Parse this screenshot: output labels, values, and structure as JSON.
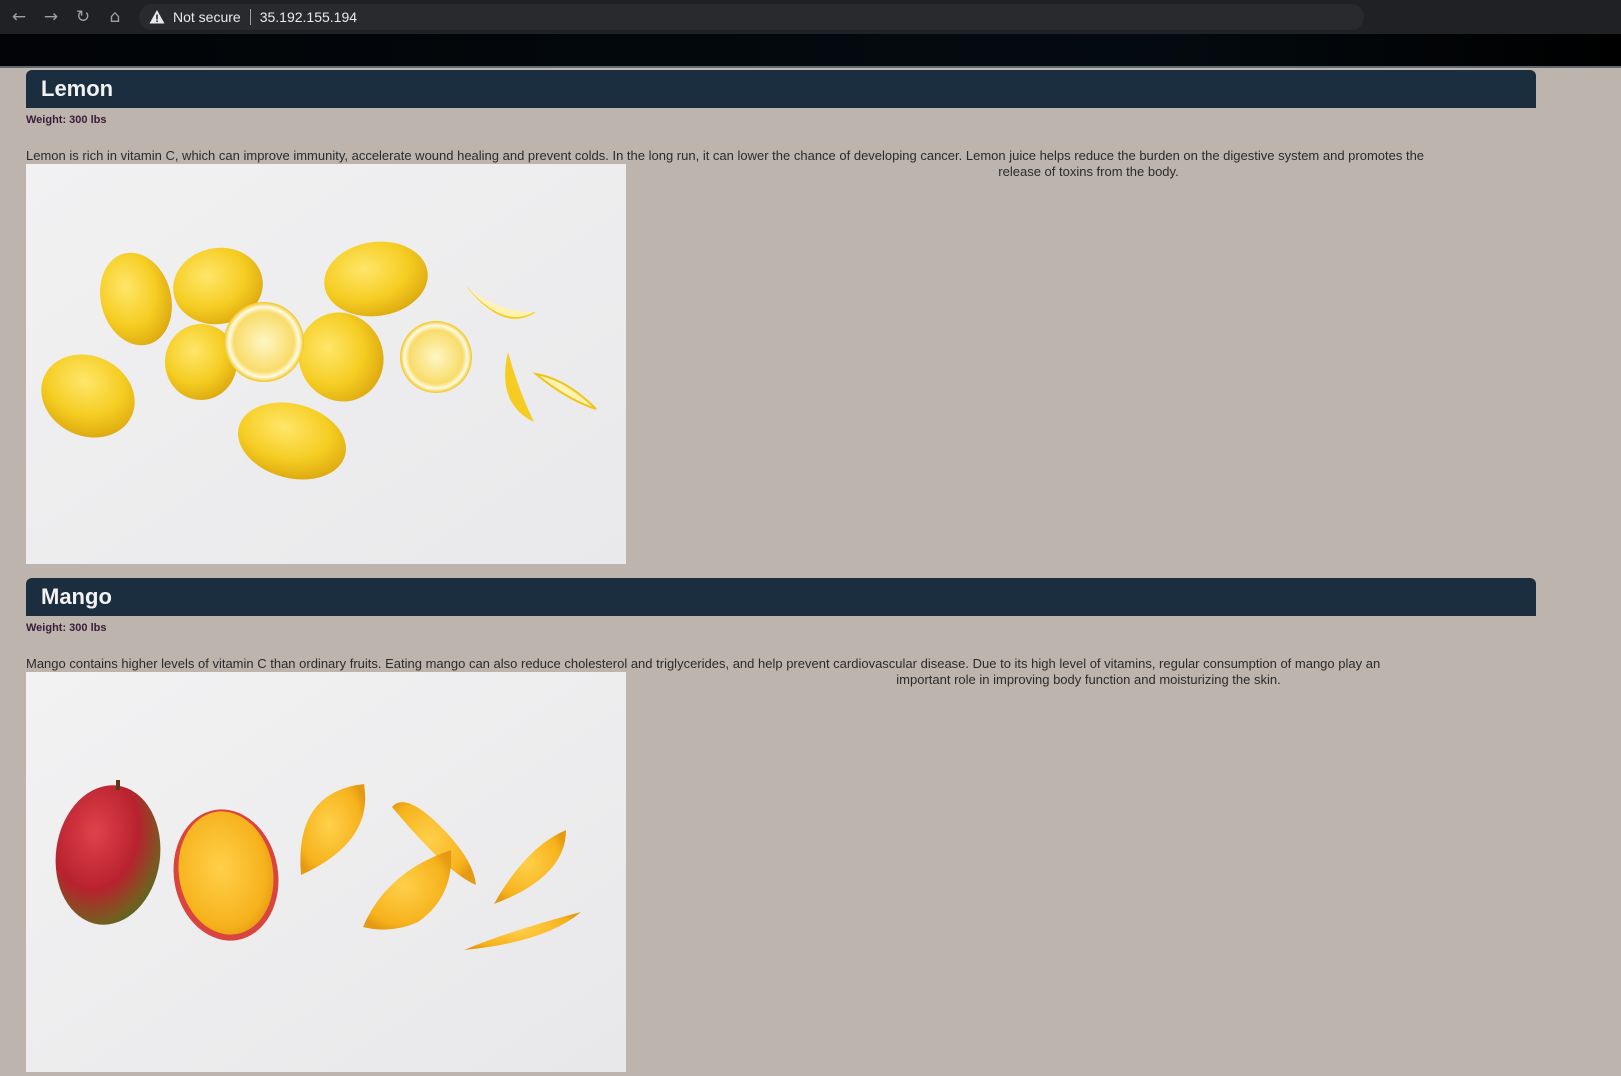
{
  "browser": {
    "security_label": "Not secure",
    "url": "35.192.155.194",
    "icons": [
      "back-arrow-icon",
      "forward-arrow-icon",
      "reload-icon",
      "home-icon",
      "warning-icon"
    ]
  },
  "colors": {
    "page_background": "#bdb4ae",
    "header_bar": "#1b2e40",
    "weight_text": "#3b1c3a"
  },
  "products": [
    {
      "name": "Lemon",
      "weight": "Weight: 300 lbs",
      "description_line1": "Lemon is rich in vitamin C, which can improve immunity, accelerate wound healing and prevent colds. In the long run, it can lower the chance of developing cancer. Lemon juice helps reduce the burden on the digestive system and promotes the",
      "description_line2": "release of toxins from the body.",
      "image": "lemons-photo"
    },
    {
      "name": "Mango",
      "weight": "Weight: 300 lbs",
      "description_line1": "Mango contains higher levels of vitamin C than ordinary fruits. Eating mango can also reduce cholesterol and triglycerides, and help prevent cardiovascular disease. Due to its high level of vitamins, regular consumption of mango play an",
      "description_line2": "important role in improving body function and moisturizing the skin.",
      "image": "mangoes-photo"
    }
  ]
}
